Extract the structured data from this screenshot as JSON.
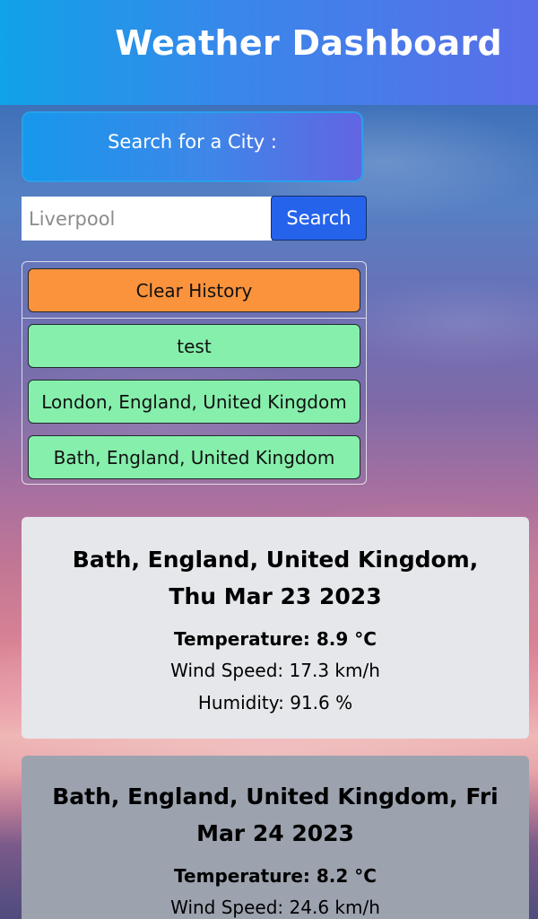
{
  "header": {
    "title": "Weather Dashboard"
  },
  "search": {
    "label": "Search for a City :",
    "placeholder": "Liverpool",
    "value": "",
    "button_label": "Search"
  },
  "history": {
    "clear_label": "Clear History",
    "items": [
      "test",
      "London, England, United Kingdom",
      "Bath, England, United Kingdom"
    ]
  },
  "forecast": [
    {
      "heading": "Bath, England, United Kingdom, Thu Mar 23 2023",
      "temperature": "Temperature: 8.9 °C",
      "wind": "Wind Speed: 17.3 km/h",
      "humidity": "Humidity: 91.6 %"
    },
    {
      "heading": "Bath, England, United Kingdom, Fri Mar 24 2023",
      "temperature": "Temperature: 8.2 °C",
      "wind": "Wind Speed: 24.6 km/h"
    }
  ],
  "colors": {
    "header_gradient": [
      "#11a2e8",
      "#5a6ee9"
    ],
    "search_button": "#2563eb",
    "clear_button": "#fb923c",
    "history_button": "#86efac",
    "card_today": "#e5e7eb",
    "card_next": "#9ca3af"
  }
}
